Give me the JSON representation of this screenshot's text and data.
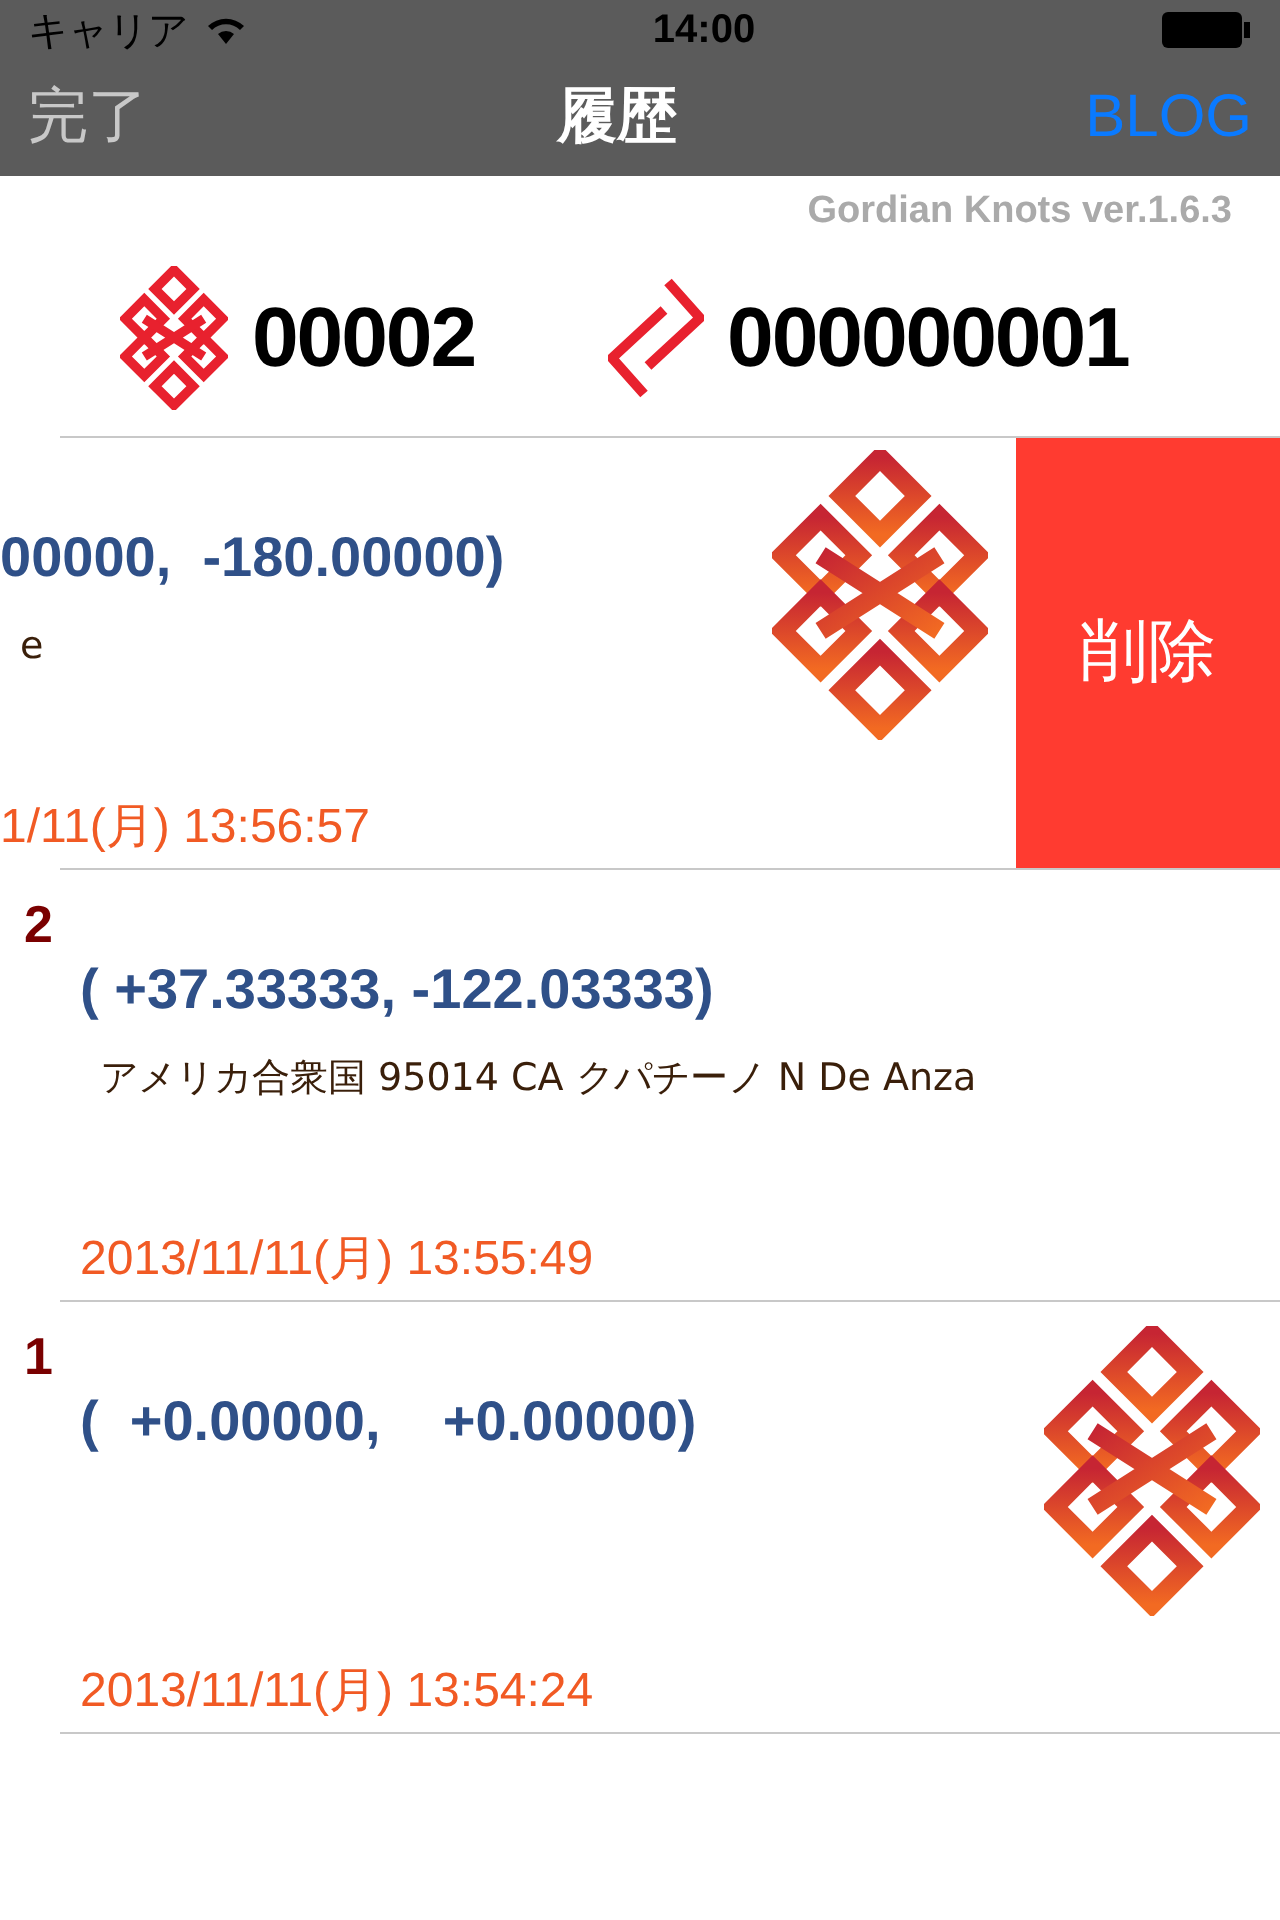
{
  "status_bar": {
    "carrier": "キャリア",
    "time": "14:00"
  },
  "nav": {
    "left": "完了",
    "title": "履歴",
    "right": "BLOG"
  },
  "version": "Gordian Knots ver.1.6.3",
  "counters": [
    {
      "kind": "knot",
      "value": "00002"
    },
    {
      "kind": "link",
      "value": "000000001"
    }
  ],
  "rows": [
    {
      "number": "",
      "coords": "00000,  -180.00000)",
      "address": "e",
      "date": "1/11(月) 13:56:57",
      "icon": true,
      "swiped": true,
      "action": "削除"
    },
    {
      "number": "2",
      "coords": "( +37.33333, -122.03333)",
      "address": "アメリカ合衆国 95014 CA クパチーノ N De Anza",
      "date": "2013/11/11(月) 13:55:49",
      "icon": false,
      "swiped": false
    },
    {
      "number": "1",
      "coords": "(  +0.00000,    +0.00000)",
      "address": "",
      "date": "2013/11/11(月) 13:54:24",
      "icon": true,
      "swiped": false
    }
  ]
}
